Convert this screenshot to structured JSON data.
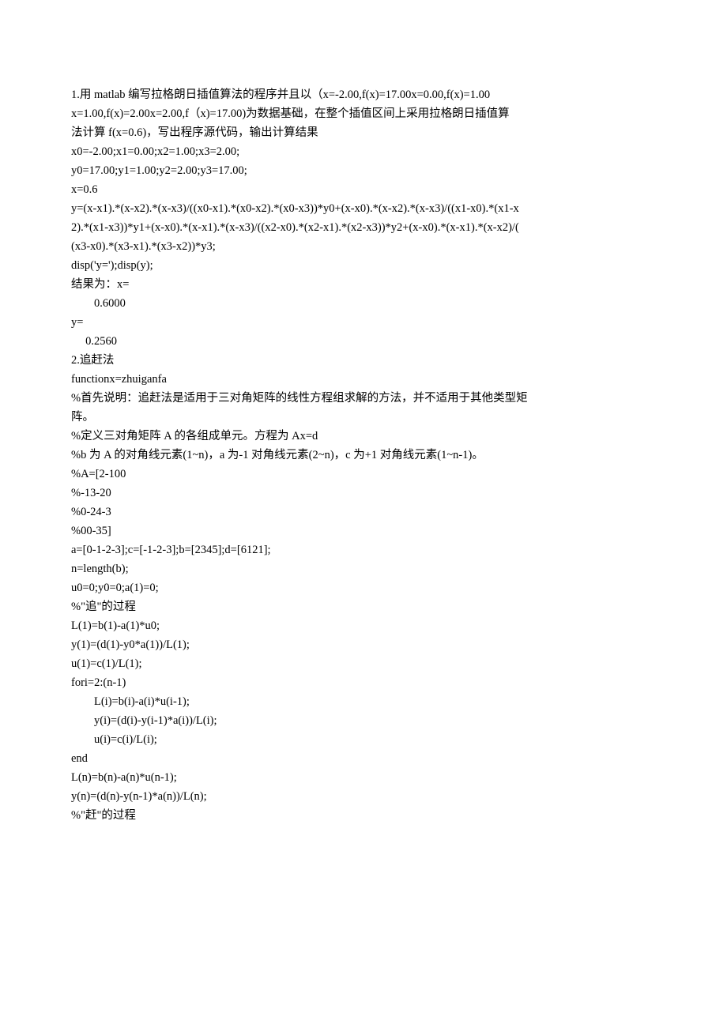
{
  "lines": [
    {
      "cls": "line",
      "text": "1.用 matlab 编写拉格朗日插值算法的程序并且以（x=-2.00,f(x)=17.00x=0.00,f(x)=1.00"
    },
    {
      "cls": "line",
      "text": "x=1.00,f(x)=2.00x=2.00,f（x)=17.00)为数据基础，在整个插值区间上采用拉格朗日插值算"
    },
    {
      "cls": "line",
      "text": "法计算 f(x=0.6)，写出程序源代码，输出计算结果"
    },
    {
      "cls": "line",
      "text": "x0=-2.00;x1=0.00;x2=1.00;x3=2.00;"
    },
    {
      "cls": "line",
      "text": "y0=17.00;y1=1.00;y2=2.00;y3=17.00;"
    },
    {
      "cls": "line",
      "text": "x=0.6"
    },
    {
      "cls": "line",
      "text": "y=(x-x1).*(x-x2).*(x-x3)/((x0-x1).*(x0-x2).*(x0-x3))*y0+(x-x0).*(x-x2).*(x-x3)/((x1-x0).*(x1-x"
    },
    {
      "cls": "line",
      "text": "2).*(x1-x3))*y1+(x-x0).*(x-x1).*(x-x3)/((x2-x0).*(x2-x1).*(x2-x3))*y2+(x-x0).*(x-x1).*(x-x2)/("
    },
    {
      "cls": "line",
      "text": "(x3-x0).*(x3-x1).*(x3-x2))*y3;"
    },
    {
      "cls": "line",
      "text": "disp('y=');disp(y);"
    },
    {
      "cls": "line",
      "text": ""
    },
    {
      "cls": "line",
      "text": "结果为：x="
    },
    {
      "cls": "line",
      "text": ""
    },
    {
      "cls": "line indent1",
      "text": "0.6000"
    },
    {
      "cls": "line",
      "text": ""
    },
    {
      "cls": "line",
      "text": "y="
    },
    {
      "cls": "line",
      "text": "     0.2560"
    },
    {
      "cls": "line",
      "text": "2.追赶法"
    },
    {
      "cls": "line",
      "text": "functionx=zhuiganfa"
    },
    {
      "cls": "line",
      "text": "%首先说明：追赶法是适用于三对角矩阵的线性方程组求解的方法，并不适用于其他类型矩"
    },
    {
      "cls": "line",
      "text": "阵。"
    },
    {
      "cls": "line",
      "text": "%定义三对角矩阵 A 的各组成单元。方程为 Ax=d"
    },
    {
      "cls": "line",
      "text": "%b 为 A 的对角线元素(1~n)，a 为-1 对角线元素(2~n)，c 为+1 对角线元素(1~n-1)。"
    },
    {
      "cls": "line",
      "text": "%A=[2-100"
    },
    {
      "cls": "line",
      "text": "%-13-20"
    },
    {
      "cls": "line",
      "text": "%0-24-3"
    },
    {
      "cls": "line",
      "text": "%00-35]"
    },
    {
      "cls": "line",
      "text": "a=[0-1-2-3];c=[-1-2-3];b=[2345];d=[6121];"
    },
    {
      "cls": "line",
      "text": "n=length(b);"
    },
    {
      "cls": "line",
      "text": "u0=0;y0=0;a(1)=0;"
    },
    {
      "cls": "line",
      "text": "%\"追\"的过程"
    },
    {
      "cls": "line",
      "text": "L(1)=b(1)-a(1)*u0;"
    },
    {
      "cls": "line",
      "text": "y(1)=(d(1)-y0*a(1))/L(1);"
    },
    {
      "cls": "line",
      "text": "u(1)=c(1)/L(1);"
    },
    {
      "cls": "line",
      "text": "fori=2:(n-1)"
    },
    {
      "cls": "line indent1",
      "text": "L(i)=b(i)-a(i)*u(i-1);"
    },
    {
      "cls": "line indent1",
      "text": "y(i)=(d(i)-y(i-1)*a(i))/L(i);"
    },
    {
      "cls": "line indent1",
      "text": "u(i)=c(i)/L(i);"
    },
    {
      "cls": "line",
      "text": "end"
    },
    {
      "cls": "line",
      "text": "L(n)=b(n)-a(n)*u(n-1);"
    },
    {
      "cls": "line",
      "text": "y(n)=(d(n)-y(n-1)*a(n))/L(n);"
    },
    {
      "cls": "line",
      "text": "%\"赶\"的过程"
    }
  ]
}
